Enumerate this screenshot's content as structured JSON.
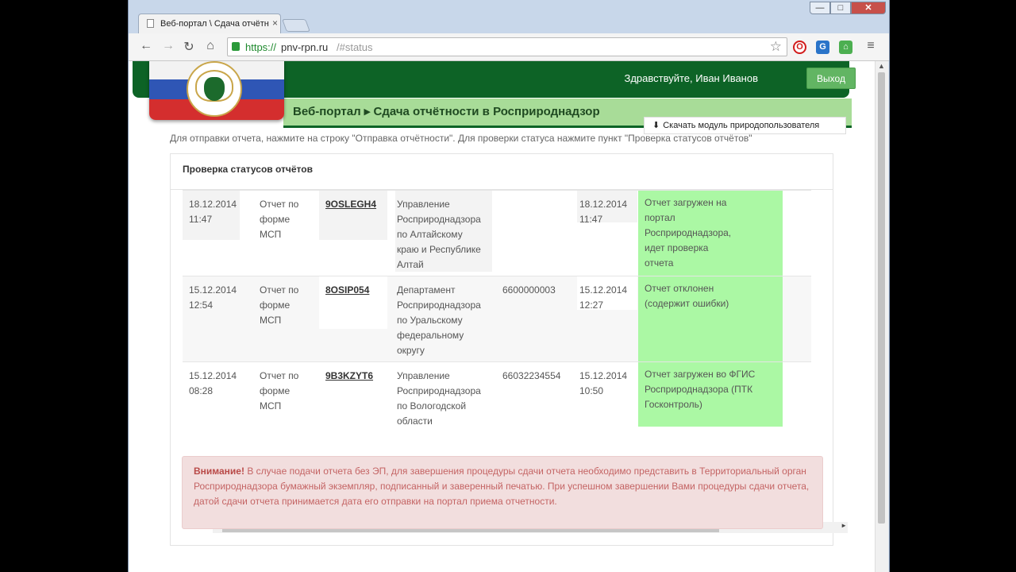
{
  "browser": {
    "tab_title": "Веб-портал \\ Сдача отчётн",
    "tab_close": "×",
    "url_scheme": "https://",
    "url_host": "pnv-rpn.ru",
    "url_path": "/#status",
    "window_buttons": {
      "minimize": "—",
      "maximize": "□",
      "close": "✕"
    },
    "icons": [
      "back-icon",
      "forward-icon",
      "reload-icon",
      "home-icon",
      "lock-icon",
      "star-icon",
      "opera-extension-icon",
      "g-extension-icon",
      "house-extension-icon",
      "menu-icon"
    ]
  },
  "header": {
    "greeting": "Здравствуйте, Иван Иванов",
    "logout": "Выход",
    "title": "Веб-портал ▸ Сдача отчётности в Росприроднадзор",
    "download_button": "Скачать модуль природопользователя"
  },
  "instruction": "Для отправки отчета, нажмите на строку \"Отправка отчётности\". Для проверки статуса нажмите пункт \"Проверка статусов отчётов\"",
  "panel": {
    "title": "Проверка статусов отчётов",
    "rows": [
      {
        "date_sent": "18.12.2014\n11:47",
        "form": "Отчет по\nформе\nМСП",
        "code": "9OSLEGH4",
        "department": "Управление\nРосприроднадзора\nпо Алтайскому\nкраю и Республике\nАлтай",
        "inn": "",
        "date_status": "18.12.2014\n11:47",
        "status": "Отчет загружен на\nпортал\nРосприроднадзора,\nидет проверка\nотчета"
      },
      {
        "date_sent": "15.12.2014\n12:54",
        "form": "Отчет по\nформе\nМСП",
        "code": "8OSIP054",
        "department": "Департамент\nРосприроднадзора\nпо Уральскому\nфедеральному\nокругу",
        "inn": "6600000003",
        "date_status": "15.12.2014\n12:27",
        "status": "Отчет отклонен\n(содержит ошибки)"
      },
      {
        "date_sent": "15.12.2014\n08:28",
        "form": "Отчет по\nформе\nМСП",
        "code": "9B3KZYT6",
        "department": "Управление\nРосприроднадзора\nпо Вологодской\nобласти",
        "inn": "66032234554",
        "date_status": "15.12.2014\n10:50",
        "status": "Отчет загружен во ФГИС\nРосприроднадзора (ПТК\nГосконтроль)"
      }
    ]
  },
  "alert": {
    "strong": "Внимание!",
    "text": " В случае подачи отчета без ЭП, для завершения процедуры сдачи отчета необходимо представить в Территориальный орган Росприроднадзора бумажный экземпляр, подписанный и заверенный печатью. При успешном завершении Вами процедуры сдачи отчета, датой сдачи отчета принимается дата его отправки на портал приема отчетности."
  },
  "colors": {
    "header_green": "#0d6326",
    "title_band": "#a8dc98",
    "status_highlight": "#abf8a4",
    "logout_button": "#62b563",
    "alert_bg": "#f2dede"
  }
}
